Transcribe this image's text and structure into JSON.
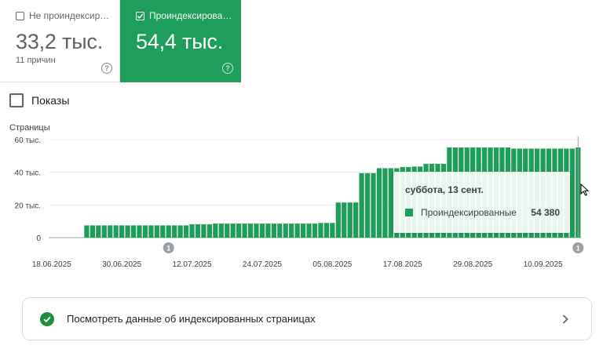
{
  "cards": [
    {
      "label": "Не проиндексир…",
      "value": "33,2 тыс.",
      "sub": "11 причин",
      "selected": false
    },
    {
      "label": "Проиндексирова…",
      "value": "54,4 тыс.",
      "sub": "",
      "selected": true
    }
  ],
  "toggle": {
    "label": "Показы",
    "checked": false
  },
  "colors": {
    "accent": "#1e9e5a",
    "bar": "#1e9e5a",
    "grid": "#e8eaed",
    "text": "#5f6368"
  },
  "chart_data": {
    "type": "bar",
    "ylabel": "Страницы",
    "ylim": [
      0,
      60000
    ],
    "yticks": [
      "0",
      "20 тыс.",
      "40 тыс.",
      "60 тыс."
    ],
    "ytick_values": [
      0,
      20000,
      40000,
      60000
    ],
    "xtick_labels": [
      "18.06.2025",
      "30.06.2025",
      "12.07.2025",
      "24.07.2025",
      "05.08.2025",
      "17.08.2025",
      "29.08.2025",
      "10.09.2025"
    ],
    "xtick_index": [
      0,
      12,
      24,
      36,
      48,
      60,
      72,
      84
    ],
    "series": [
      {
        "name": "Проиндексированные",
        "values": [
          0,
          0,
          0,
          0,
          0,
          0,
          7500,
          7500,
          7500,
          7500,
          7500,
          7500,
          7500,
          7500,
          7500,
          7500,
          7500,
          7500,
          7500,
          7500,
          7500,
          7500,
          7500,
          7500,
          8200,
          8200,
          8200,
          8200,
          8600,
          8600,
          8600,
          8600,
          8600,
          8600,
          8600,
          8600,
          8600,
          8600,
          8600,
          8600,
          8600,
          8600,
          8600,
          8600,
          8600,
          8600,
          9000,
          9000,
          9000,
          21500,
          21500,
          21500,
          21500,
          39500,
          39500,
          39500,
          42500,
          42500,
          42500,
          42500,
          43200,
          43200,
          43500,
          43500,
          45200,
          45200,
          45200,
          45200,
          55200,
          55200,
          55200,
          55200,
          55200,
          55200,
          55200,
          55200,
          55200,
          55200,
          55200,
          54500,
          54500,
          54500,
          54500,
          54500,
          54500,
          54500,
          54500,
          54500,
          54500,
          54500,
          55200
        ]
      }
    ],
    "annotations": [
      {
        "label": "1",
        "index": 20
      },
      {
        "label": "1",
        "index": 90
      }
    ]
  },
  "tooltip": {
    "date": "суббота, 13 сент.",
    "series": "Проиндексированные",
    "value": "54 380"
  },
  "link": {
    "label": "Посмотреть данные об индексированных страницах"
  }
}
